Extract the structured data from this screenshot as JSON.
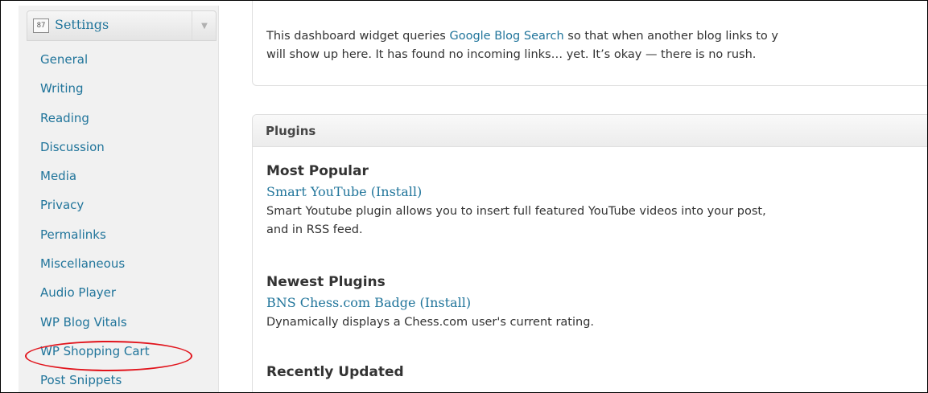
{
  "sidebar": {
    "settings_icon_text": "87",
    "settings_title": "Settings",
    "toggle_glyph": "▼",
    "items": [
      {
        "label": "General"
      },
      {
        "label": "Writing"
      },
      {
        "label": "Reading"
      },
      {
        "label": "Discussion"
      },
      {
        "label": "Media"
      },
      {
        "label": "Privacy"
      },
      {
        "label": "Permalinks"
      },
      {
        "label": "Miscellaneous"
      },
      {
        "label": "Audio Player"
      },
      {
        "label": "WP Blog Vitals"
      },
      {
        "label": "WP Shopping Cart"
      },
      {
        "label": "Post Snippets"
      }
    ],
    "highlight_color": "#e1141c"
  },
  "incoming_links": {
    "text_before": "This dashboard widget queries ",
    "link": "Google Blog Search",
    "text_after": " so that when another blog links to y",
    "line2": "will show up here. It has found no incoming links… yet. It’s okay — there is no rush."
  },
  "plugins": {
    "title": "Plugins",
    "sections": [
      {
        "heading": "Most Popular",
        "name": "Smart YouTube",
        "open": " (",
        "install": "Install",
        "close": ")",
        "desc1": "Smart Youtube plugin allows you to insert full featured YouTube videos into your post,",
        "desc2": "and in RSS feed."
      },
      {
        "heading": "Newest Plugins",
        "name": "BNS Chess.com Badge",
        "open": " (",
        "install": "Install",
        "close": ")",
        "desc1": "Dynamically displays a Chess.com user's current rating."
      },
      {
        "heading": "Recently Updated"
      }
    ]
  },
  "colors": {
    "link": "#21759b",
    "text": "#333333",
    "sidebar_bg": "#f1f1f1"
  }
}
